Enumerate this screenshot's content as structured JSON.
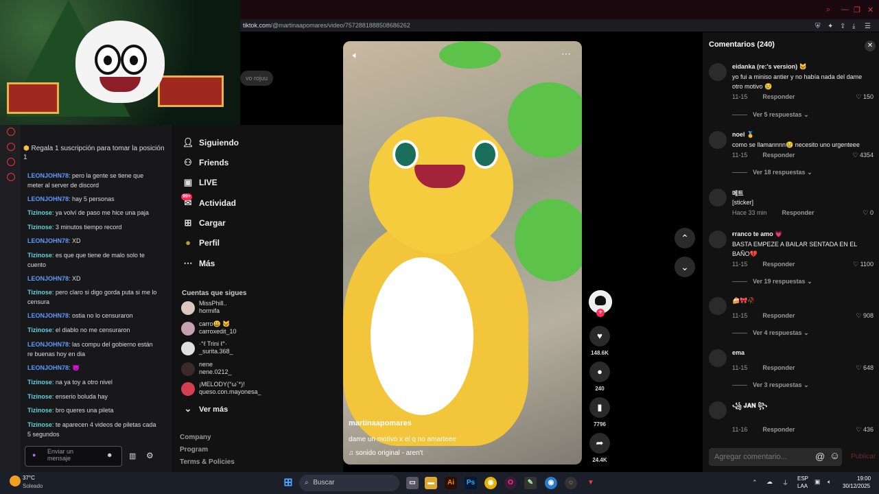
{
  "browser": {
    "url_domain": "tiktok.com",
    "url_path": "/@martinaapomares/video/7572881888508686262",
    "window_controls": [
      "search-icon",
      "minimize-icon",
      "restore-icon",
      "close-icon"
    ]
  },
  "stream_chat": {
    "pinned": "Regala 1 suscripción para tomar la posición 1",
    "messages": [
      {
        "user": "LEONJOHN78",
        "text": ": pero la gente se tiene que meter al server de discord",
        "style": "u1"
      },
      {
        "user": "LEONJOHN78",
        "text": ": hay 5 personas",
        "style": "u1"
      },
      {
        "user": "Tizinose",
        "text": ": ya volví de paso me hice una paja",
        "style": "u2"
      },
      {
        "user": "Tizinose",
        "text": ": 3 minutos tiempo record",
        "style": "u2"
      },
      {
        "user": "LEONJOHN78",
        "text": ": XD",
        "style": "u1"
      },
      {
        "user": "Tizinose",
        "text": ": es que que tiene de malo solo te cuento",
        "style": "u2"
      },
      {
        "user": "LEONJOHN78",
        "text": ": XD",
        "style": "u1"
      },
      {
        "user": "Tizinose",
        "text": ": pero claro si digo gorda puta si me lo censura",
        "style": "u2"
      },
      {
        "user": "LEONJOHN78",
        "text": ": ostia no lo censuraron",
        "style": "u1"
      },
      {
        "user": "Tizinose",
        "text": ": el diablo no me censuraron",
        "style": "u2"
      },
      {
        "user": "LEONJOHN78",
        "text": ": las compu del gobierno están re buenas hoy en dia",
        "style": "u1"
      },
      {
        "user": "LEONJOHN78",
        "text": ": 😈",
        "style": "u1"
      },
      {
        "user": "Tizinose",
        "text": ": na ya toy a otro nivel",
        "style": "u2"
      },
      {
        "user": "Tizinose",
        "text": ": enserio boluda hay",
        "style": "u2"
      },
      {
        "user": "Tizinose",
        "text": ": bro queres una pileta",
        "style": "u2"
      },
      {
        "user": "Tizinose",
        "text": ": te aparecen 4 videos de piletas cada 5 segundos",
        "style": "u2"
      }
    ],
    "input_placeholder": "Enviar un mensaje"
  },
  "nav": {
    "search_stub": "vo rojuu",
    "items": [
      {
        "label": "Siguiendo",
        "icon": "following-icon"
      },
      {
        "label": "Friends",
        "icon": "friends-icon"
      },
      {
        "label": "LIVE",
        "icon": "live-icon"
      },
      {
        "label": "Actividad",
        "icon": "activity-icon",
        "badge": "99+"
      },
      {
        "label": "Cargar",
        "icon": "upload-icon"
      },
      {
        "label": "Perfil",
        "icon": "profile-icon"
      },
      {
        "label": "Más",
        "icon": "more-icon"
      }
    ],
    "following_title": "Cuentas que sigues",
    "accounts": [
      {
        "name": "MissPhill..",
        "handle": "hormifa"
      },
      {
        "name": "carro😃 🐱",
        "handle": "carroxedit_10"
      },
      {
        "name": "·°ℓ Trini ℓ°·",
        "handle": "_surita.368_"
      },
      {
        "name": "nene",
        "handle": "nene.0212_"
      },
      {
        "name": "¡MELODY(°ω`*)!",
        "handle": "queso.con.mayonesa_"
      }
    ],
    "see_more": "Ver más",
    "footer": [
      "Company",
      "Program",
      "Terms & Policies"
    ]
  },
  "video": {
    "author": "martinaapomares",
    "caption": "dame un motivo x el q no amarteee",
    "sound": "sonido original - aren't",
    "likes": "148.6K",
    "comments": "240",
    "saves": "7796",
    "shares": "24.4K"
  },
  "comments_panel": {
    "title": "Comentarios (240)",
    "reply_label": "Responder",
    "items": [
      {
        "name": "eidanka (re:'s version) 🐱",
        "text": "yo fui a miniso antier y no había nada del dame otro motivo 😢",
        "date": "11-15",
        "likes": "150",
        "replies": "Ver 5 respuestas"
      },
      {
        "name": "noel 🥇",
        "text": "como se llamannnn😢 necesito uno urgenteee",
        "date": "11-15",
        "likes": "4354",
        "replies": "Ver 18 respuestas"
      },
      {
        "name": "메트",
        "text": "[sticker]",
        "date": "Hace 33 min",
        "likes": "0",
        "replies": ""
      },
      {
        "name": "ғranco te amo 💗",
        "text": "BASTA EMPEZE A BAILAR SENTADA EN EL BAÑO💔",
        "date": "11-15",
        "likes": "1100",
        "replies": "Ver 19 respuestas"
      },
      {
        "name": "🍰🎀🥀",
        "text": "",
        "date": "11-15",
        "likes": "908",
        "replies": "Ver 4 respuestas"
      },
      {
        "name": "ema",
        "text": "",
        "date": "11-15",
        "likes": "648",
        "replies": "Ver 3 respuestas"
      },
      {
        "name": "꧁ 𝐉𝐀𝐍 ꧂",
        "text": "",
        "date": "11-16",
        "likes": "436",
        "replies": ""
      }
    ],
    "input_placeholder": "Agregar comentario...",
    "post_label": "Publicar"
  },
  "taskbar": {
    "weather_temp": "37°C",
    "weather_desc": "Soleado",
    "search_label": "Buscar",
    "lang1": "ESP",
    "lang2": "LAA",
    "time": "19:00",
    "date": "30/12/2025"
  }
}
